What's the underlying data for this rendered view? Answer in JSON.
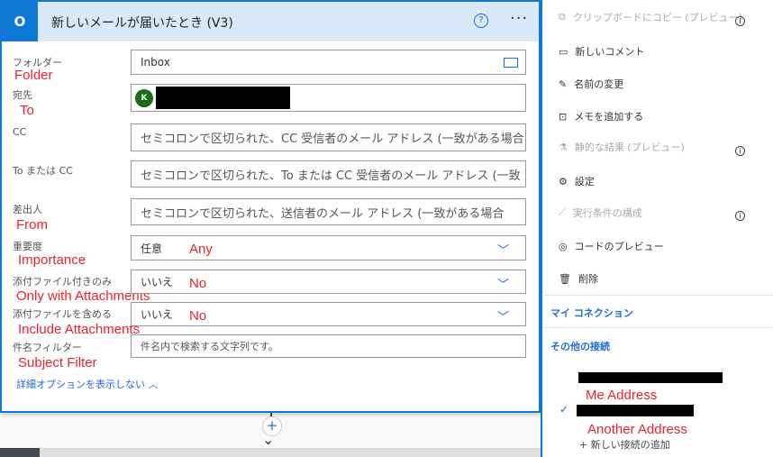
{
  "card": {
    "title": "新しいメールが届いたとき (V3)",
    "logo": "O",
    "help_icon": "question-circle-icon",
    "more_icon": "ellipsis-icon"
  },
  "fields": [
    {
      "label": "フォルダー",
      "annotation": "Folder",
      "value": "Inbox"
    },
    {
      "label": "宛先",
      "annotation": "To",
      "avatar": "K"
    },
    {
      "label": "CC",
      "placeholder": "セミコロンで区切られた、CC 受信者のメール アドレス (一致がある場合"
    },
    {
      "label": "To または CC",
      "placeholder": "セミコロンで区切られた、To または CC 受信者のメール アドレス (一致"
    },
    {
      "label": "差出人",
      "annotation": "From",
      "placeholder": "セミコロンで区切られた、送信者のメール アドレス (一致がある場合"
    },
    {
      "label": "重要度",
      "annotation": "Importance",
      "value": "任意",
      "value_annotation": "Any"
    },
    {
      "label": "添付ファイル付きのみ",
      "annotation": "Only with Attachments",
      "value": "いいえ",
      "value_annotation": "No"
    },
    {
      "label": "添付ファイルを含める",
      "annotation": "Include Attachments",
      "value": "いいえ",
      "value_annotation": "No"
    },
    {
      "label": "件名フィルター",
      "annotation": "Subject Filter",
      "placeholder": "件名内で検索する文字列です。"
    }
  ],
  "advanced_link": "詳細オプションを表示しない",
  "menu": [
    {
      "label": "クリップボードにコピー (プレビュー)",
      "icon": "copy-icon",
      "disabled": true,
      "info": true
    },
    {
      "label": "新しいコメント",
      "icon": "comment-icon"
    },
    {
      "label": "名前の変更",
      "icon": "pencil-icon"
    },
    {
      "label": "メモを追加する",
      "icon": "note-icon"
    },
    {
      "label": "静的な結果 (プレビュー)",
      "icon": "flask-icon",
      "disabled": true,
      "info": true
    },
    {
      "label": "設定",
      "icon": "gear-icon"
    },
    {
      "label": "実行条件の構成",
      "icon": "run-after-icon",
      "disabled": true,
      "info": true
    },
    {
      "label": "コードのプレビュー",
      "icon": "eye-icon"
    },
    {
      "label": "削除",
      "icon": "trash-icon"
    }
  ],
  "connections": {
    "my_label": "マイ コネクション",
    "other_label": "その他の接続",
    "me_annotation": "Me Address",
    "another_annotation": "Another Address",
    "add_label": "+ 新しい接続の追加"
  }
}
